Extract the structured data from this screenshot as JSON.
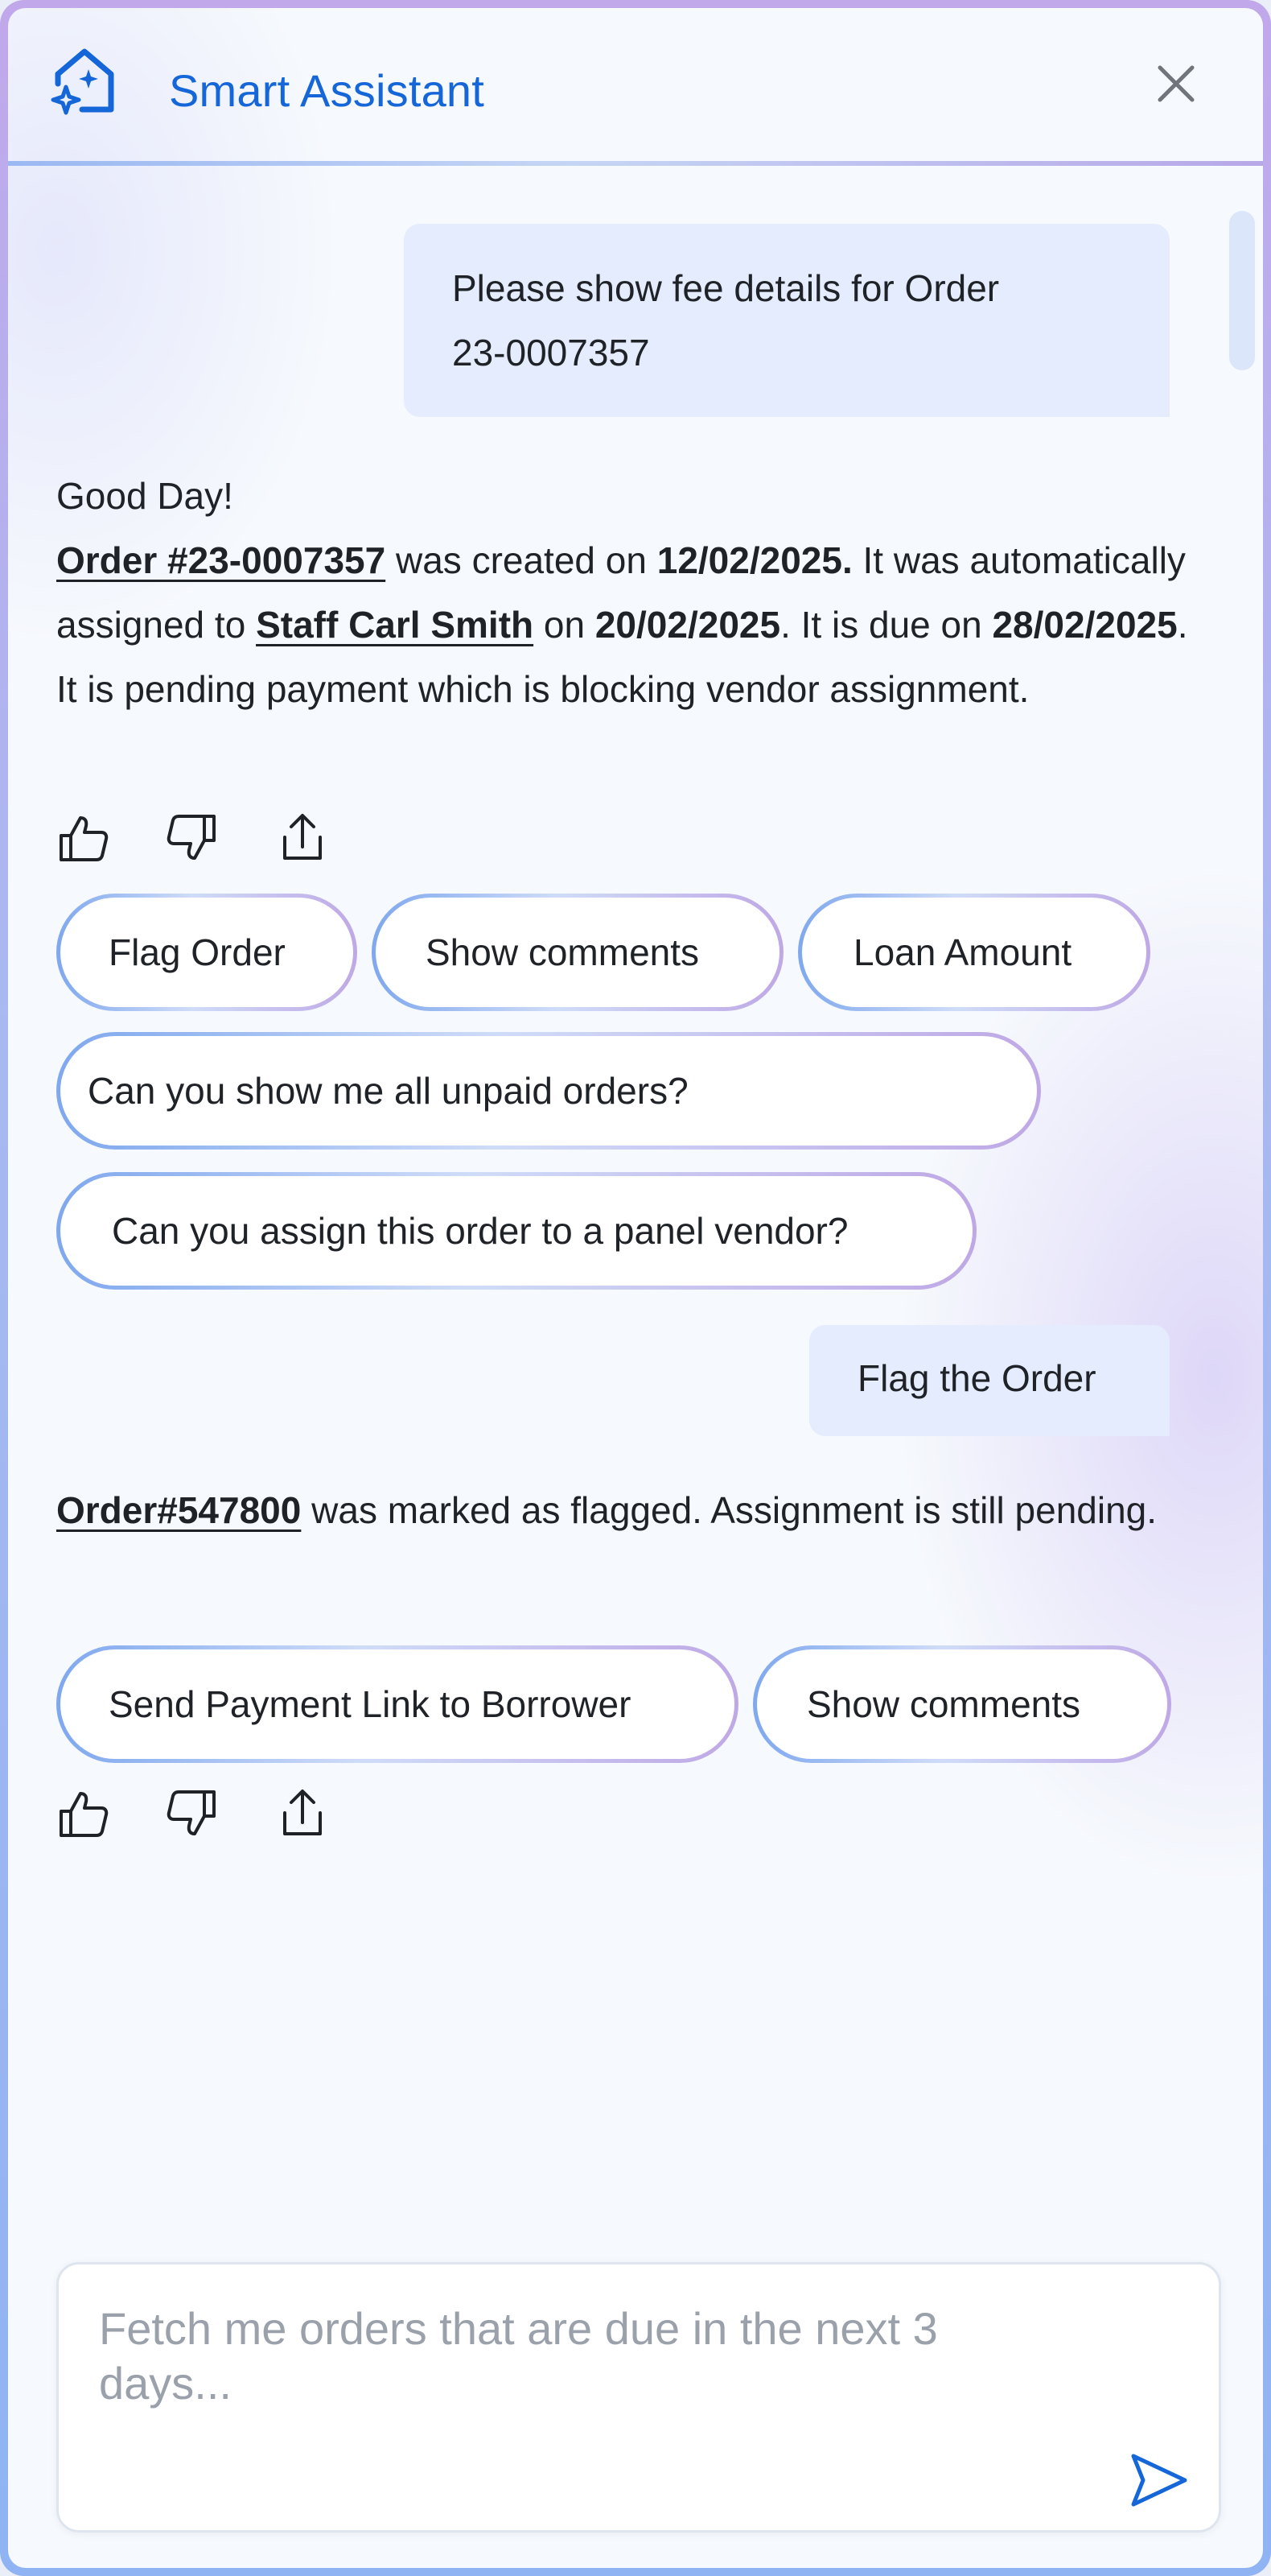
{
  "header": {
    "title": "Smart Assistant"
  },
  "colors": {
    "brand": "#1566d8",
    "user_bubble": "#e4ecfd",
    "gradient_start": "#7fa8ee",
    "gradient_end": "#bfa8e6"
  },
  "icons": {
    "logo": "house-sparkle-icon",
    "close": "close-icon",
    "like": "thumbs-up-icon",
    "dislike": "thumbs-down-icon",
    "share": "share-icon",
    "send": "send-icon"
  },
  "messages": {
    "user1": {
      "line1": "Please show fee details for Order",
      "line2": "23-0007357"
    },
    "bot1": {
      "greeting": "Good Day!",
      "order_link": "Order #23-0007357",
      "t1": " was created on ",
      "created": "12/02/2025.",
      "t2": " It was automatically assigned to ",
      "staff_link": "Staff Carl Smith",
      "t3": " on ",
      "assigned": "20/02/2025",
      "t4": ". It is due on ",
      "due": "28/02/2025",
      "t5": ". It is pending payment which is blocking vendor assignment."
    },
    "user2": {
      "text": "Flag the Order"
    },
    "bot2": {
      "order_link": "Order#547800",
      "t1": " was marked as flagged. Assignment is still pending."
    }
  },
  "suggestions1": [
    "Flag Order",
    "Show comments",
    "Loan Amount",
    "Can you show me all unpaid orders?",
    "Can you assign this order to a panel vendor?"
  ],
  "suggestions2": [
    "Send Payment Link to Borrower",
    "Show comments"
  ],
  "input": {
    "placeholder": "Fetch me orders that are due in the next 3 days...",
    "value": ""
  }
}
